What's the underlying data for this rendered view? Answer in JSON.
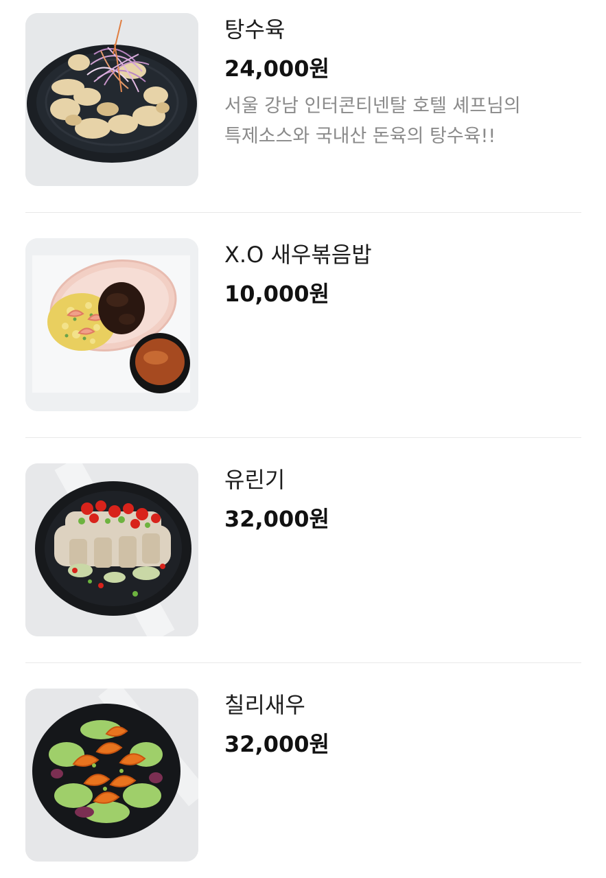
{
  "menu": {
    "items": [
      {
        "name": "탕수육",
        "price": "24,000원",
        "description_line1": "서울 강남 인터콘티넨탈 호텔 셰프님의",
        "description_line2": "특제소스와 국내산 돈육의 탕수육!!"
      },
      {
        "name": "X.O 새우볶음밥",
        "price": "10,000원"
      },
      {
        "name": "유린기",
        "price": "32,000원"
      },
      {
        "name": "칠리새우",
        "price": "32,000원"
      }
    ]
  }
}
